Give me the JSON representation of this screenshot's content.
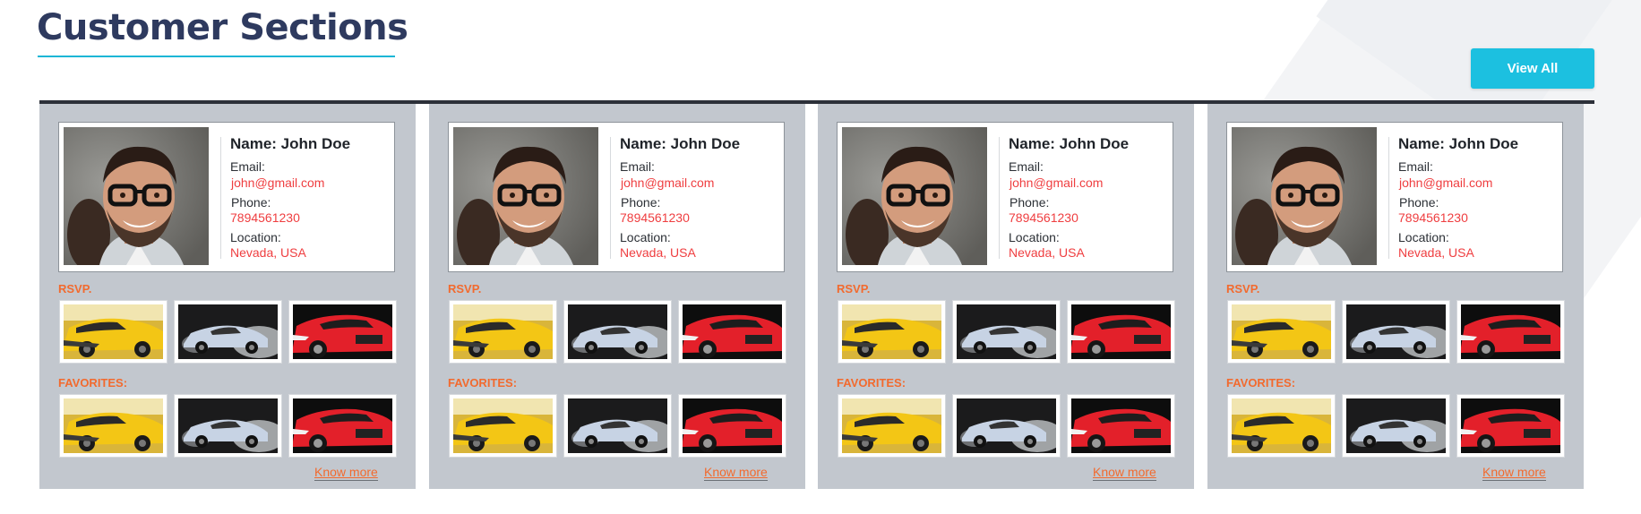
{
  "page": {
    "title": "Customer Sections",
    "view_all_label": "View All"
  },
  "customers": [
    {
      "name": "Name: John Doe",
      "email_label": "Email:",
      "email": "john@gmail.com",
      "phone_label": "Phone:",
      "phone": "7894561230",
      "location_label": "Location:",
      "location": "Nevada, USA",
      "rsvp_label": "RSVP.",
      "favorites_label": "FAVORITES:",
      "know_more": "Know more"
    },
    {
      "name": "Name: John Doe",
      "email_label": "Email:",
      "email": "john@gmail.com",
      "phone_label": "Phone:",
      "phone": "7894561230",
      "location_label": "Location:",
      "location": "Nevada, USA",
      "rsvp_label": "RSVP.",
      "favorites_label": "FAVORITES:",
      "know_more": "Know more"
    },
    {
      "name": "Name: John Doe",
      "email_label": "Email:",
      "email": "john@gmail.com",
      "phone_label": "Phone:",
      "phone": "7894561230",
      "location_label": "Location:",
      "location": "Nevada, USA",
      "rsvp_label": "RSVP.",
      "favorites_label": "FAVORITES:",
      "know_more": "Know more"
    },
    {
      "name": "Name: John Doe",
      "email_label": "Email:",
      "email": "john@gmail.com",
      "phone_label": "Phone:",
      "phone": "7894561230",
      "location_label": "Location:",
      "location": "Nevada, USA",
      "rsvp_label": "RSVP.",
      "favorites_label": "FAVORITES:",
      "know_more": "Know more"
    }
  ],
  "car_images": [
    "yellow-sports-car",
    "silver-sports-car-smoke",
    "red-sports-car"
  ],
  "colors": {
    "accent": "#1cc0e0",
    "title": "#2e3a5f",
    "card_bg": "#c2c7ce",
    "label_orange": "#f26a2e",
    "value_red": "#ef3e40"
  }
}
